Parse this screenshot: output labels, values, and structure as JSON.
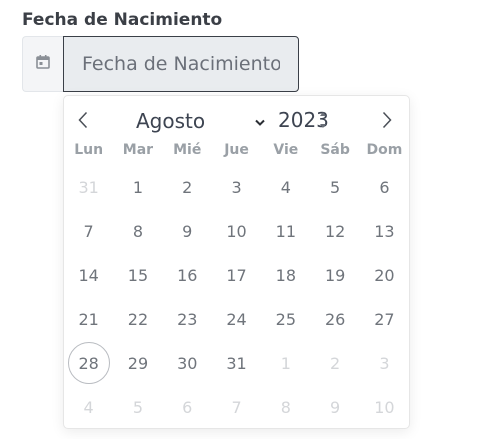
{
  "field": {
    "label": "Fecha de Nacimiento",
    "placeholder": "Fecha de Nacimiento",
    "prefix_icon": "calendar-icon"
  },
  "calendar": {
    "month": "Agosto",
    "year": "2023",
    "weekdays": [
      "Lun",
      "Mar",
      "Mié",
      "Jue",
      "Vie",
      "Sáb",
      "Dom"
    ],
    "weeks": [
      [
        {
          "d": "31",
          "other": true
        },
        {
          "d": "1"
        },
        {
          "d": "2"
        },
        {
          "d": "3"
        },
        {
          "d": "4"
        },
        {
          "d": "5"
        },
        {
          "d": "6"
        }
      ],
      [
        {
          "d": "7"
        },
        {
          "d": "8"
        },
        {
          "d": "9"
        },
        {
          "d": "10"
        },
        {
          "d": "11"
        },
        {
          "d": "12"
        },
        {
          "d": "13"
        }
      ],
      [
        {
          "d": "14"
        },
        {
          "d": "15"
        },
        {
          "d": "16"
        },
        {
          "d": "17"
        },
        {
          "d": "18"
        },
        {
          "d": "19"
        },
        {
          "d": "20"
        }
      ],
      [
        {
          "d": "21"
        },
        {
          "d": "22"
        },
        {
          "d": "23"
        },
        {
          "d": "24"
        },
        {
          "d": "25"
        },
        {
          "d": "26"
        },
        {
          "d": "27"
        }
      ],
      [
        {
          "d": "28",
          "today": true
        },
        {
          "d": "29"
        },
        {
          "d": "30"
        },
        {
          "d": "31"
        },
        {
          "d": "1",
          "other": true
        },
        {
          "d": "2",
          "other": true
        },
        {
          "d": "3",
          "other": true
        }
      ],
      [
        {
          "d": "4",
          "other": true
        },
        {
          "d": "5",
          "other": true
        },
        {
          "d": "6",
          "other": true
        },
        {
          "d": "7",
          "other": true
        },
        {
          "d": "8",
          "other": true
        },
        {
          "d": "9",
          "other": true
        },
        {
          "d": "10",
          "other": true
        }
      ]
    ]
  },
  "colors": {
    "text": "#3d4451",
    "muted": "#6f747b",
    "other_month": "#d4d6d9",
    "input_bg": "#e9ecef",
    "prefix_bg": "#f4f5f7"
  }
}
